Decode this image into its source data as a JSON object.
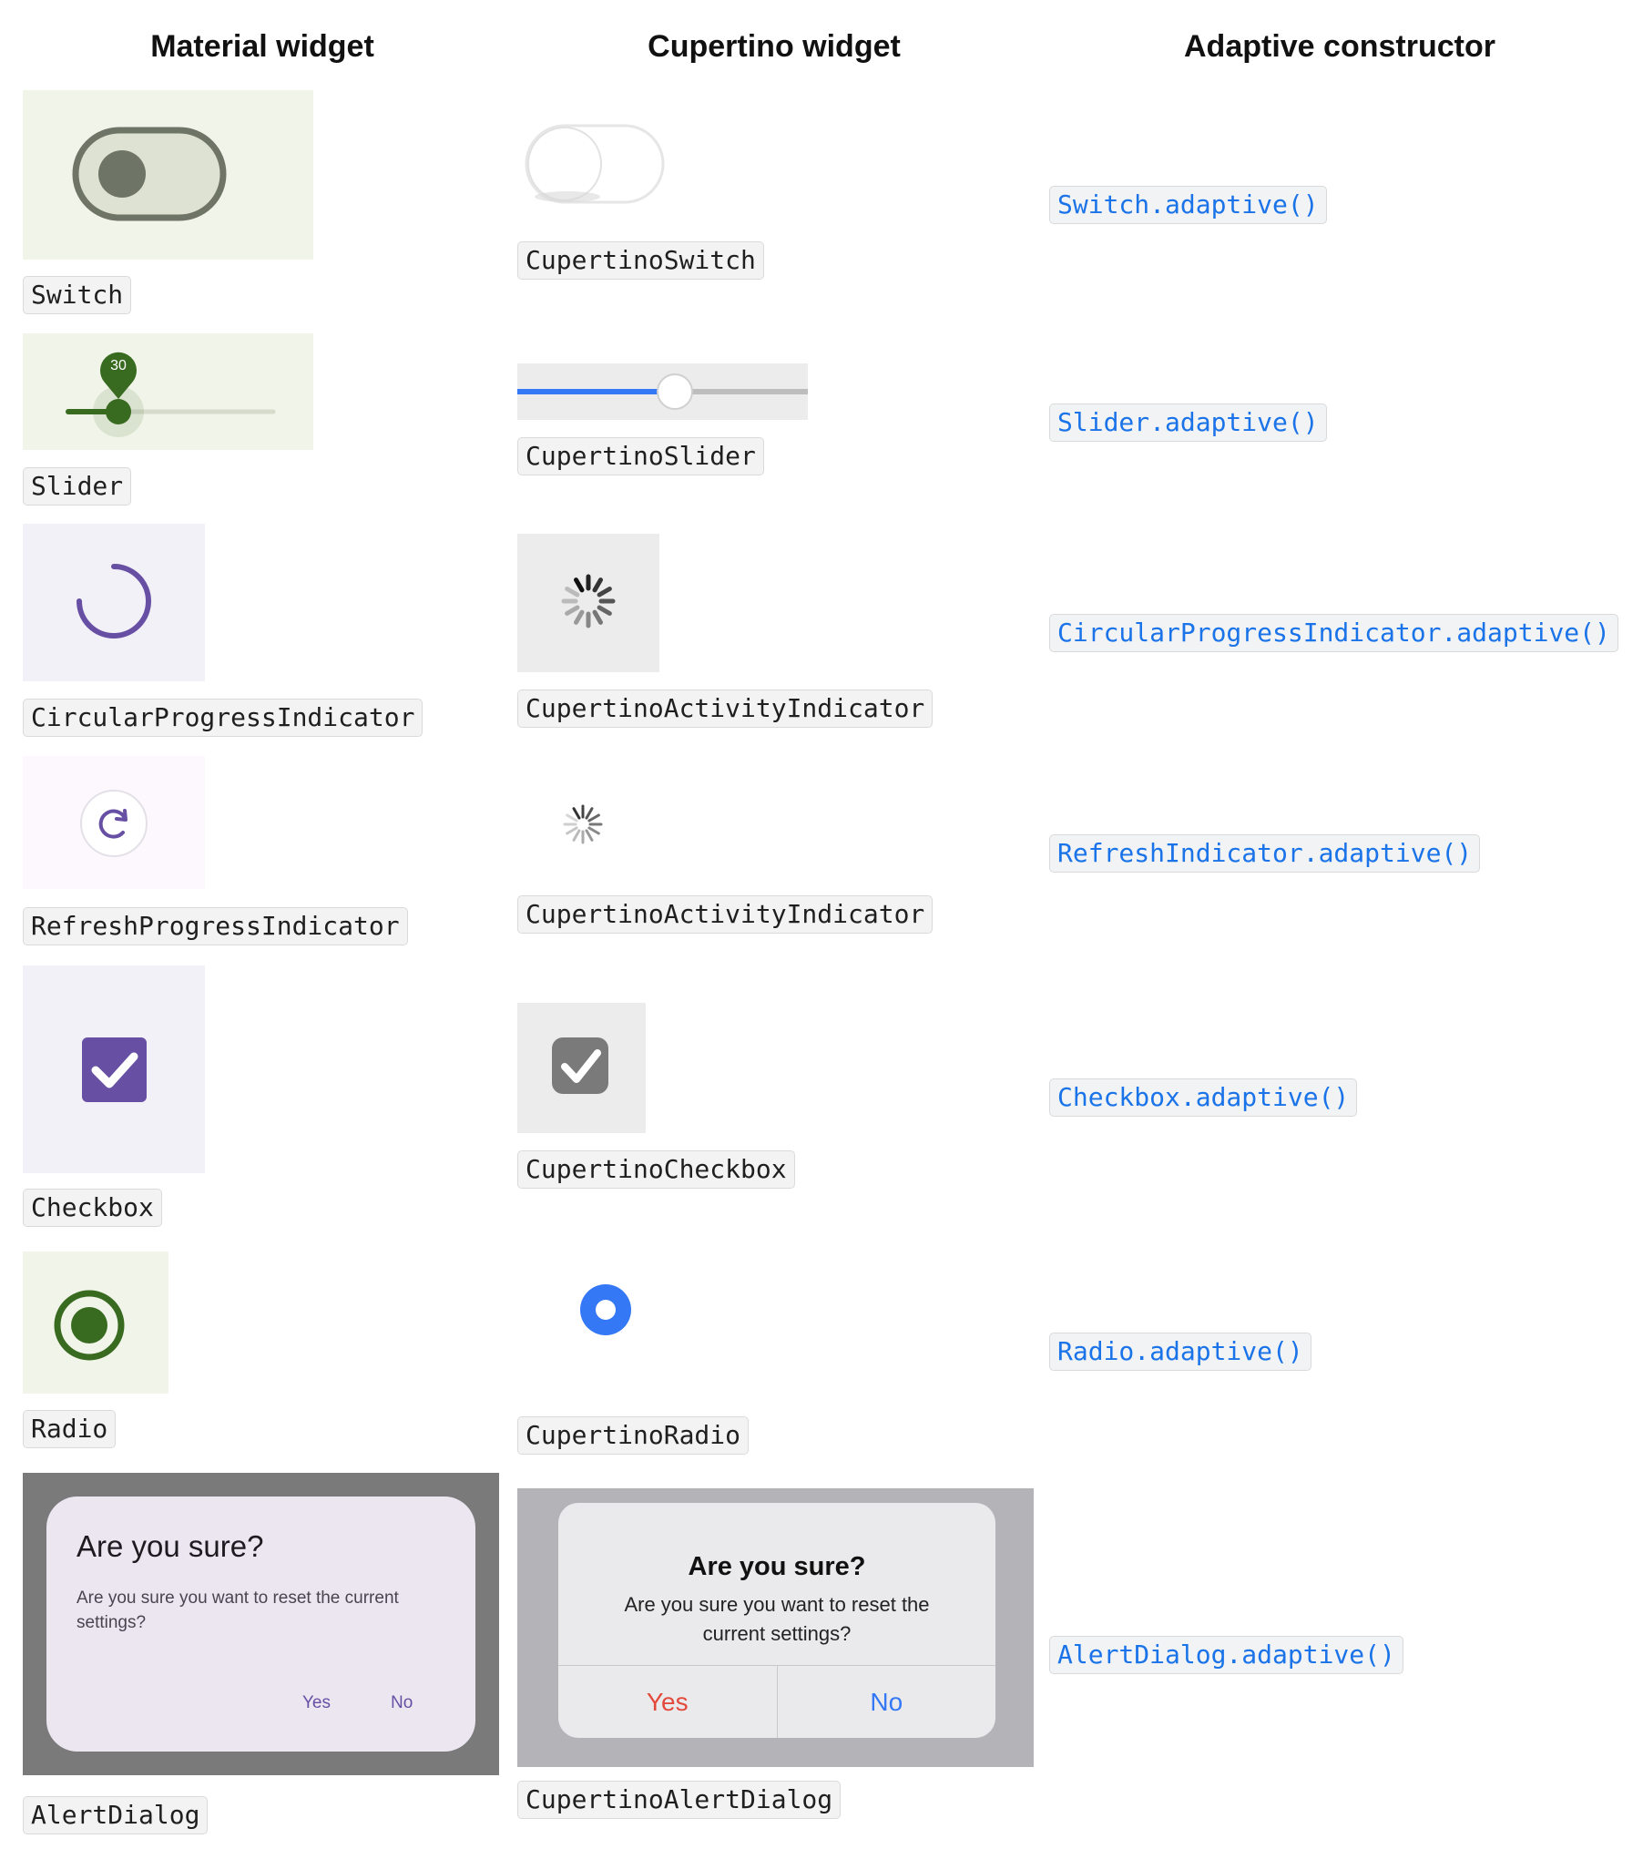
{
  "headers": {
    "material": "Material widget",
    "cupertino": "Cupertino widget",
    "adaptive": "Adaptive constructor"
  },
  "rows": [
    {
      "material": "Switch",
      "cupertino": "CupertinoSwitch",
      "adaptive": "Switch.adaptive()"
    },
    {
      "material": "Slider",
      "cupertino": "CupertinoSlider",
      "adaptive": "Slider.adaptive()",
      "slider_value_label": "30"
    },
    {
      "material": "CircularProgressIndicator",
      "cupertino": "CupertinoActivityIndicator",
      "adaptive": "CircularProgressIndicator.adaptive()"
    },
    {
      "material": "RefreshProgressIndicator",
      "cupertino": "CupertinoActivityIndicator",
      "adaptive": "RefreshIndicator.adaptive()"
    },
    {
      "material": "Checkbox",
      "cupertino": "CupertinoCheckbox",
      "adaptive": "Checkbox.adaptive()"
    },
    {
      "material": "Radio",
      "cupertino": "CupertinoRadio",
      "adaptive": "Radio.adaptive()"
    },
    {
      "material": "AlertDialog",
      "cupertino": "CupertinoAlertDialog",
      "adaptive": "AlertDialog.adaptive()"
    }
  ],
  "dialog": {
    "title": "Are you sure?",
    "message": "Are you sure you want to reset the current settings?",
    "yes": "Yes",
    "no": "No"
  },
  "colors": {
    "material_green": "#386a20",
    "material_purple": "#6750a4",
    "cupertino_blue": "#3478f6",
    "cupertino_red": "#e24a3b",
    "link_blue": "#1a73e8"
  }
}
